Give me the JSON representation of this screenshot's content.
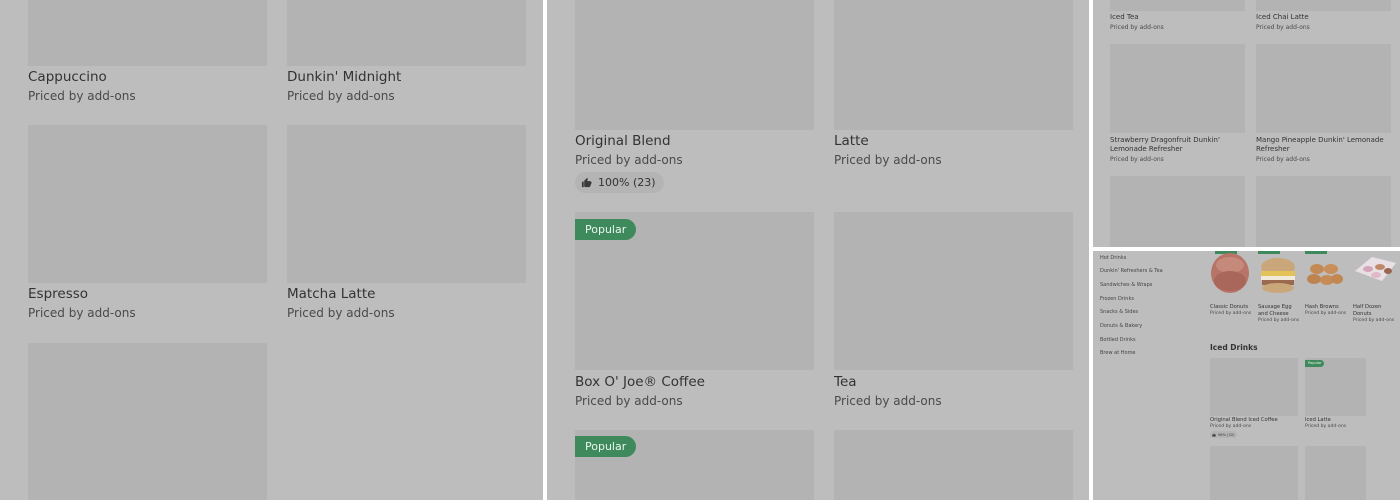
{
  "panel_a": {
    "items": [
      {
        "name": "Cappuccino",
        "sub": "Priced by add-ons"
      },
      {
        "name": "Dunkin' Midnight",
        "sub": "Priced by add-ons"
      },
      {
        "name": "Espresso",
        "sub": "Priced by add-ons"
      },
      {
        "name": "Matcha Latte",
        "sub": "Priced by add-ons"
      }
    ]
  },
  "panel_b": {
    "items": [
      {
        "name": "Original Blend",
        "sub": "Priced by add-ons"
      },
      {
        "name": "Latte",
        "sub": "Priced by add-ons"
      },
      {
        "name": "Box O' Joe® Coffee",
        "sub": "Priced by add-ons"
      },
      {
        "name": "Tea",
        "sub": "Priced by add-ons"
      }
    ],
    "rating": "100% (23)",
    "badge": "Popular"
  },
  "panel_c": {
    "items": [
      {
        "name": "Iced Tea",
        "sub": "Priced by add-ons"
      },
      {
        "name": "Iced Chai Latte",
        "sub": "Priced by add-ons"
      },
      {
        "name": "Strawberry Dragonfruit Dunkin' Lemonade Refresher",
        "sub": "Priced by add-ons"
      },
      {
        "name": "Mango Pineapple Dunkin' Lemonade Refresher",
        "sub": "Priced by add-ons"
      }
    ]
  },
  "panel_d": {
    "sidebar": [
      "Hot Drinks",
      "Dunkin' Refreshers & Tea",
      "Sandwiches & Wraps",
      "Frozen Drinks",
      "Snacks & Sides",
      "Donuts & Bakery",
      "Bottled Drinks",
      "Brew at Home"
    ],
    "top_items": [
      {
        "name": "Classic Donuts",
        "sub": "Priced by add-ons"
      },
      {
        "name": "Sausage Egg and Cheese",
        "sub": "Priced by add-ons"
      },
      {
        "name": "Hash Browns",
        "sub": "Priced by add-ons"
      },
      {
        "name": "Half Dozen Donuts",
        "sub": "Priced by add-ons"
      }
    ],
    "section_title": "Iced Drinks",
    "iced_items": [
      {
        "name": "Original Blend Iced Coffee",
        "sub": "Priced by add-ons"
      },
      {
        "name": "Iced Latte",
        "sub": "Priced by add-ons"
      }
    ],
    "rating": "96% (32)",
    "badge": "Popular"
  },
  "colors": {
    "panel_bg": "#bdbdbd",
    "tile_bg": "#b3b3b3",
    "badge_green": "#3f8a5c"
  }
}
